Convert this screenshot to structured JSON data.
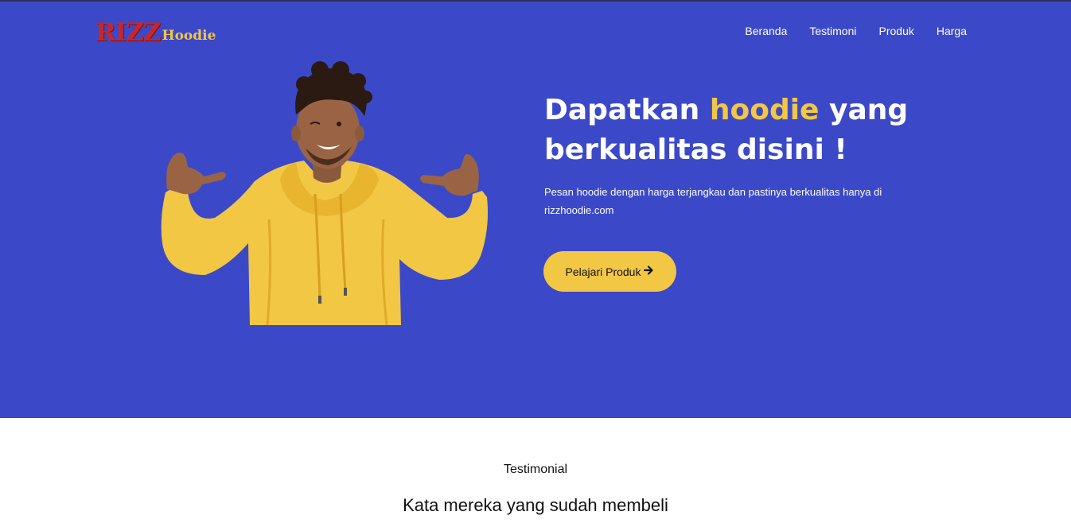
{
  "brand": {
    "name_main": "RIZZ",
    "name_sub": "Hoodie"
  },
  "nav": {
    "items": [
      {
        "label": "Beranda"
      },
      {
        "label": "Testimoni"
      },
      {
        "label": "Produk"
      },
      {
        "label": "Harga"
      }
    ]
  },
  "hero": {
    "headline_before": "Dapatkan ",
    "headline_highlight": "hoodie",
    "headline_after": " yang berkualitas disini !",
    "subtext": "Pesan hoodie dengan harga terjangkau dan pastinya berkualitas hanya di rizzhoodie.com",
    "cta_label": "Pelajari Produk",
    "cta_icon": "arrow-right-icon",
    "image_alt": "hoodie-model-photo"
  },
  "testimonial": {
    "kicker": "Testimonial",
    "title": "Kata mereka yang sudah membeli"
  },
  "colors": {
    "hero_bg": "#3b49c8",
    "accent_yellow": "#f2c744",
    "logo_red": "#c8262a",
    "text_white": "#ffffff"
  }
}
